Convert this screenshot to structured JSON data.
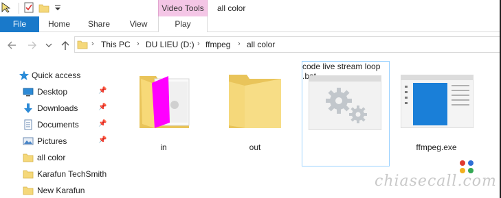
{
  "titlebar": {
    "window_title": "all color",
    "contextual_tab": "Video Tools"
  },
  "ribbon": {
    "tabs": [
      "File",
      "Home",
      "Share",
      "View",
      "Play"
    ]
  },
  "address": {
    "crumbs": [
      "This PC",
      "DU LIEU (D:)",
      "ffmpeg",
      "all color"
    ]
  },
  "nav": {
    "quick_access": "Quick access",
    "items": [
      {
        "label": "Desktop",
        "icon": "desktop-icon",
        "pinned": true
      },
      {
        "label": "Downloads",
        "icon": "downloads-icon",
        "pinned": true
      },
      {
        "label": "Documents",
        "icon": "documents-icon",
        "pinned": true
      },
      {
        "label": "Pictures",
        "icon": "pictures-icon",
        "pinned": true
      },
      {
        "label": "all color",
        "icon": "folder-icon",
        "pinned": false
      },
      {
        "label": "Karafun TechSmith",
        "icon": "folder-icon",
        "pinned": false
      },
      {
        "label": "New Karafun",
        "icon": "folder-icon",
        "pinned": false
      }
    ]
  },
  "files": [
    {
      "name": "in",
      "type": "folder-with-documents"
    },
    {
      "name": "out",
      "type": "folder"
    },
    {
      "name": "code live stream loop .bat",
      "name_line1": "code live stream loop",
      "name_line2": ".bat",
      "type": "batch-file",
      "selected": true
    },
    {
      "name": "ffmpeg.exe",
      "type": "executable"
    }
  ],
  "watermark": "chiasecall.com",
  "colors": {
    "file_tab": "#1979ca",
    "video_tools_tab": "#f4c6e6",
    "folder": "#f5d87a",
    "selection_border": "#99d1ff",
    "magenta": "#ff00ff"
  }
}
